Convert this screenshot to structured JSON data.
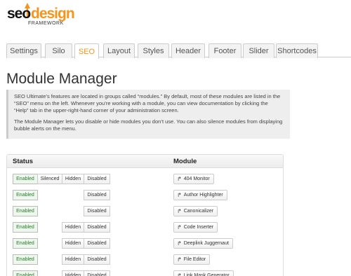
{
  "logo": {
    "seo": "seo",
    "design": "design",
    "framework": "FRAMEWORK"
  },
  "tabs": [
    {
      "label": "Settings"
    },
    {
      "label": "Silo"
    },
    {
      "label": "SEO"
    },
    {
      "label": "Layout"
    },
    {
      "label": "Styles"
    },
    {
      "label": "Header"
    },
    {
      "label": "Footer"
    },
    {
      "label": "Slider"
    },
    {
      "label": "Shortcodes"
    }
  ],
  "active_tab": "SEO",
  "page_title": "Module Manager",
  "info": {
    "p1": "SEO Ultimate’s features are located in groups called “modules.” By default, most of these modules are listed in the “SEO” menu on the left. Whenever you’re working with a module, you can view documentation by clicking the “Help” tab in the upper-right-hand corner of your administration screen.",
    "p2": "The Module Manager lets you disable or hide modules you don’t use. You can also silence modules from displaying bubble alerts on the menu."
  },
  "table": {
    "status_header": "Status",
    "module_header": "Module",
    "labels": {
      "enabled": "Enabled",
      "silenced": "Silenced",
      "hidden": "Hidden",
      "disabled": "Disabled"
    },
    "rows": [
      {
        "module": "404 Monitor",
        "silenced": true,
        "hidden": true
      },
      {
        "module": "Author Highlighter",
        "silenced": false,
        "hidden": false
      },
      {
        "module": "Canonicalizer",
        "silenced": false,
        "hidden": false
      },
      {
        "module": "Code Inserter",
        "silenced": false,
        "hidden": true
      },
      {
        "module": "Deeplink Juggernaut",
        "silenced": false,
        "hidden": true
      },
      {
        "module": "File Editor",
        "silenced": false,
        "hidden": true
      },
      {
        "module": "Link Mask Generator",
        "silenced": false,
        "hidden": true
      }
    ]
  },
  "colors": {
    "accent": "#f7941d",
    "enabled_text": "#2a7a2a"
  }
}
